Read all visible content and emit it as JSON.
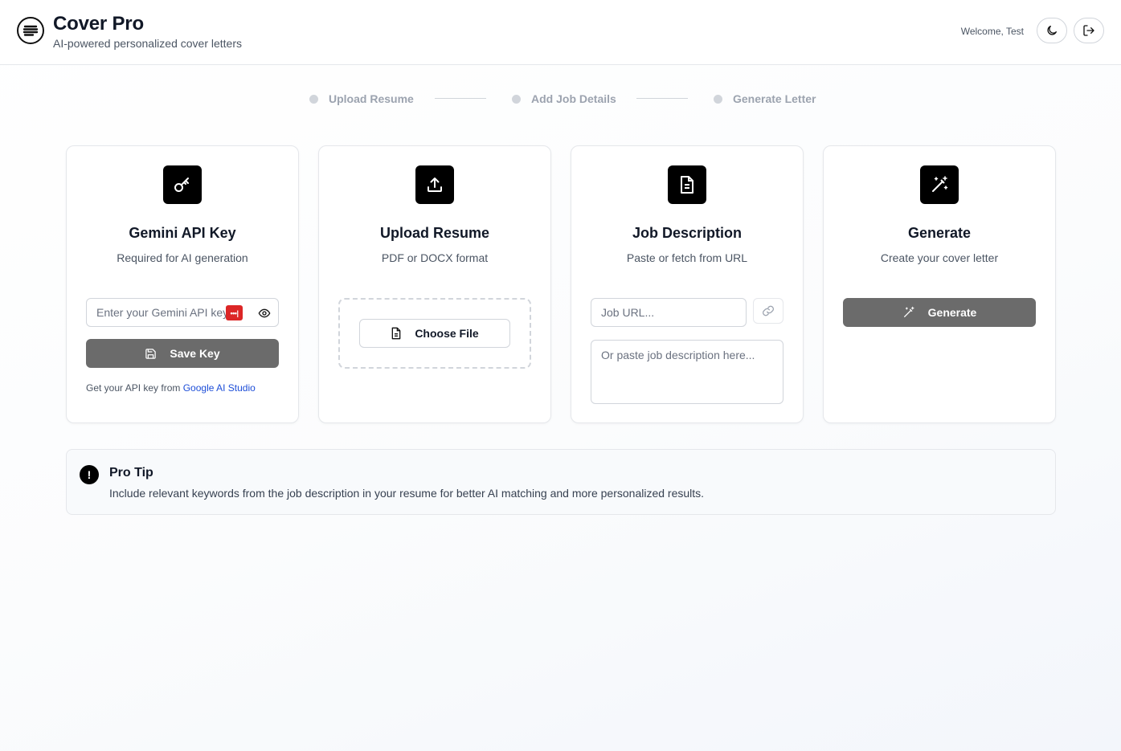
{
  "header": {
    "title": "Cover Pro",
    "subtitle": "AI-powered personalized cover letters",
    "welcome": "Welcome, Test",
    "icons": [
      "menu-lines-icon",
      "moon-icon",
      "logout-icon"
    ]
  },
  "steps": [
    {
      "label": "Upload Resume"
    },
    {
      "label": "Add Job Details"
    },
    {
      "label": "Generate Letter"
    }
  ],
  "cards": {
    "api": {
      "icon": "key-icon",
      "title": "Gemini API Key",
      "description": "Required for AI generation",
      "input_placeholder": "Enter your Gemini API key",
      "input_value": "",
      "badge": "•••|",
      "save_label": "Save Key",
      "help_prefix": "Get your API key from ",
      "help_link": "Google AI Studio"
    },
    "resume": {
      "icon": "upload-icon",
      "title": "Upload Resume",
      "description": "PDF or DOCX format",
      "choose_label": "Choose File"
    },
    "job": {
      "icon": "document-icon",
      "title": "Job Description",
      "description": "Paste or fetch from URL",
      "url_placeholder": "Job URL...",
      "url_value": "",
      "text_placeholder": "Or paste job description here...",
      "text_value": ""
    },
    "generate": {
      "icon": "magic-wand-icon",
      "title": "Generate",
      "description": "Create your cover letter",
      "button_label": "Generate"
    }
  },
  "tip": {
    "icon_glyph": "!",
    "title": "Pro Tip",
    "text": "Include relevant keywords from the job description in your resume for better AI matching and more personalized results."
  },
  "colors": {
    "primary": "#000000",
    "disabled_button": "#6b6b6b",
    "link": "#1d4ed8",
    "password_badge": "#dc2626"
  }
}
